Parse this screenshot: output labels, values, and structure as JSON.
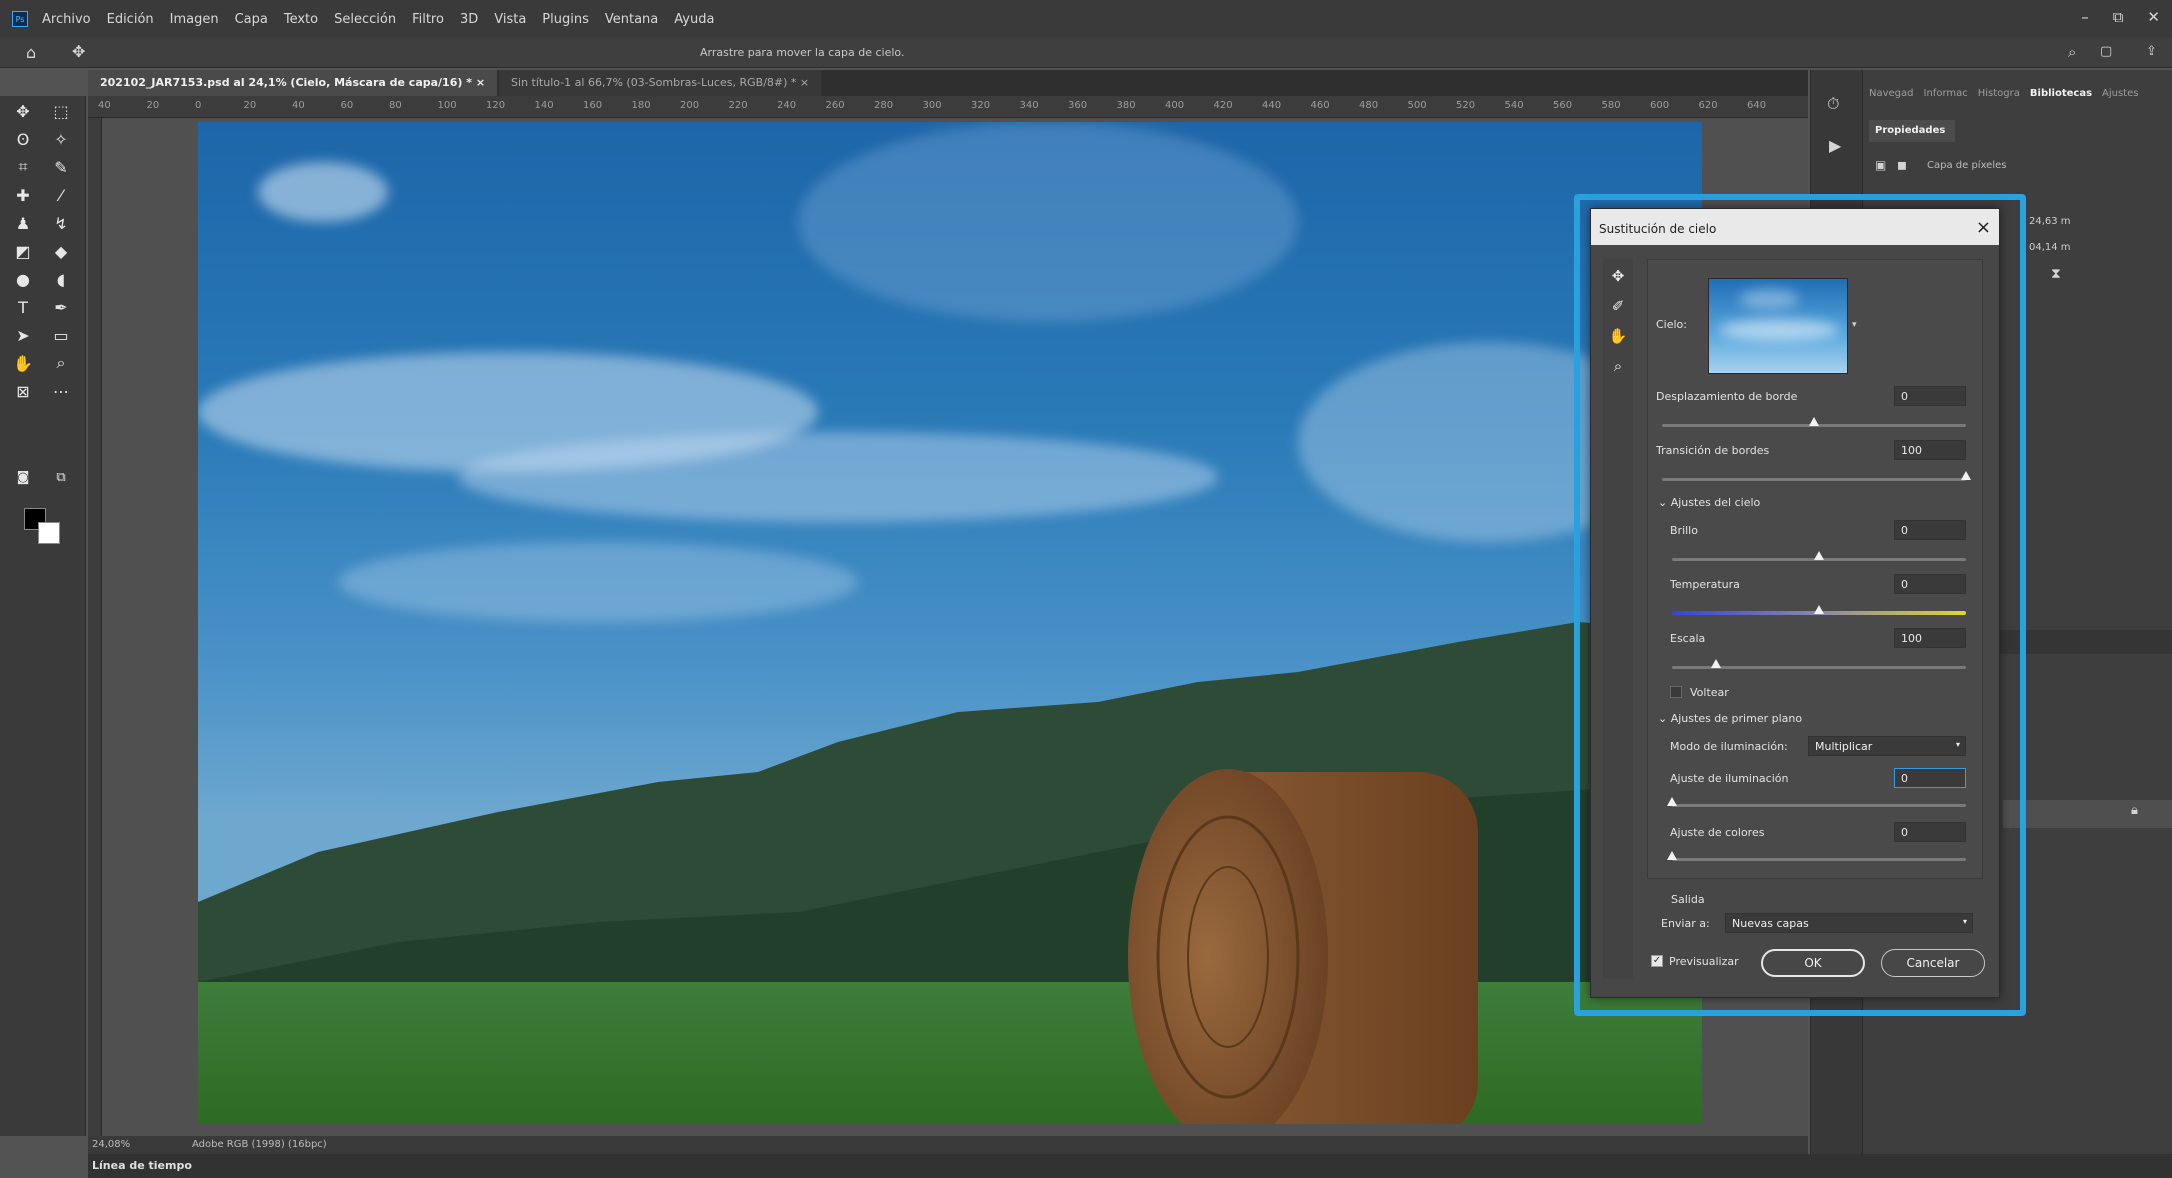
{
  "menu": [
    "Archivo",
    "Edición",
    "Imagen",
    "Capa",
    "Texto",
    "Selección",
    "Filtro",
    "3D",
    "Vista",
    "Plugins",
    "Ventana",
    "Ayuda"
  ],
  "window_controls": [
    "–",
    "⧉",
    "✕"
  ],
  "options_hint": "Arrastre para mover la capa de cielo.",
  "tabs": [
    {
      "label": "202102_JAR7153.psd al 24,1% (Cielo, Máscara de capa/16) *",
      "active": true
    },
    {
      "label": "Sin título-1 al 66,7% (03-Sombras-Luces, RGB/8#) *",
      "active": false
    }
  ],
  "ruler_ticks": [
    "40",
    "20",
    "0",
    "20",
    "40",
    "60",
    "80",
    "100",
    "120",
    "140",
    "160",
    "180",
    "200",
    "220",
    "240",
    "260",
    "280",
    "300",
    "320",
    "340",
    "360",
    "380",
    "400",
    "420",
    "440",
    "460",
    "480",
    "500",
    "520",
    "540",
    "560",
    "580",
    "600",
    "620",
    "640"
  ],
  "status": {
    "zoom": "24,08%",
    "profile": "Adobe RGB (1998) (16bpc)"
  },
  "timeline_label": "Línea de tiempo",
  "panel": {
    "tabs": [
      "Navegad",
      "Informac",
      "Histogra",
      "Bibliotecas",
      "Ajustes"
    ],
    "active_tab": "Bibliotecas",
    "properties_title": "Propiedades",
    "layer_type": "Capa de píxeles",
    "w": "24,63 m",
    "h": "04,14 m"
  },
  "dialog": {
    "title": "Sustitución de cielo",
    "sky_label": "Cielo:",
    "edge_shift": {
      "label": "Desplazamiento de borde",
      "value": "0",
      "level": 0.5
    },
    "fade_edge": {
      "label": "Transición de bordes",
      "value": "100",
      "level": 1.0
    },
    "sky_section": "Ajustes del cielo",
    "brightness": {
      "label": "Brillo",
      "value": "0",
      "level": 0.5
    },
    "temperature": {
      "label": "Temperatura",
      "value": "0",
      "level": 0.5
    },
    "scale": {
      "label": "Escala",
      "value": "100",
      "level": 0.15
    },
    "flip_label": "Voltear",
    "fg_section": "Ajustes de primer plano",
    "lighting_mode": {
      "label": "Modo de iluminación:",
      "value": "Multiplicar"
    },
    "lighting_adjust": {
      "label": "Ajuste de iluminación",
      "value": "0",
      "level": 0.0
    },
    "color_adjust": {
      "label": "Ajuste de colores",
      "value": "0",
      "level": 0.0
    },
    "output_section": "Salida",
    "output_to": {
      "label": "Enviar a:",
      "value": "Nuevas capas"
    },
    "preview_label": "Previsualizar",
    "ok": "OK",
    "cancel": "Cancelar"
  },
  "colors": {
    "highlight": "#2aa2e0",
    "accent": "#3a9be5"
  }
}
